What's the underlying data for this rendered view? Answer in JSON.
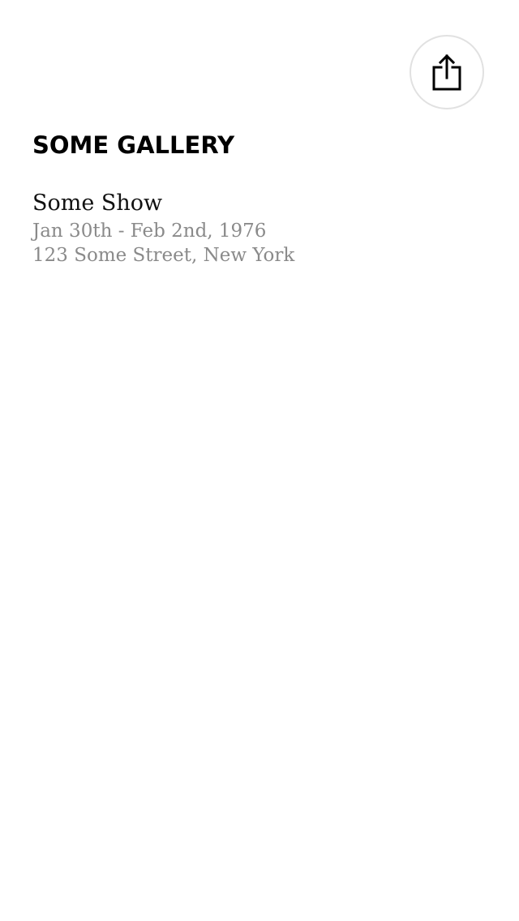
{
  "header": {
    "share_icon": "share-icon"
  },
  "gallery": {
    "name": "SOME GALLERY"
  },
  "show": {
    "title": "Some Show",
    "dates": "Jan 30th - Feb 2nd, 1976",
    "address": "123 Some Street, New York"
  },
  "colors": {
    "background": "#ffffff",
    "primary_text": "#000000",
    "secondary_text": "#8a8a8a",
    "button_border": "#e1e1e1"
  }
}
